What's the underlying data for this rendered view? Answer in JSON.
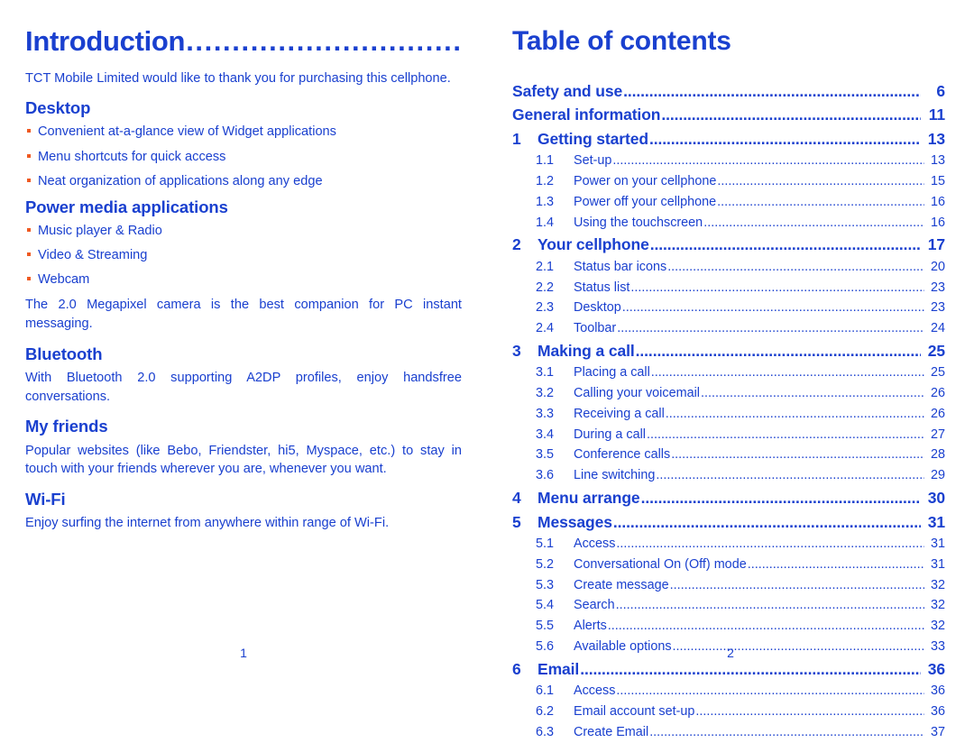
{
  "colors": {
    "text_blue": "#1a40cf",
    "bullet_orange": "#ef5a22"
  },
  "left_column": {
    "title": "Introduction",
    "title_leader": "..................................................................",
    "intro_paragraph": "TCT Mobile Limited would like to thank you for purchasing this cellphone.",
    "sections": [
      {
        "heading": "Desktop",
        "bullets": [
          "Convenient at-a-glance view of Widget applications",
          "Menu shortcuts for quick access",
          "Neat organization of applications along any edge"
        ],
        "paragraphs": []
      },
      {
        "heading": "Power media applications",
        "bullets": [
          "Music player & Radio",
          "Video & Streaming",
          "Webcam"
        ],
        "paragraphs": [
          "The 2.0 Megapixel camera is the best companion for PC instant messaging."
        ]
      },
      {
        "heading": "Bluetooth",
        "bullets": [],
        "paragraphs": [
          "With Bluetooth 2.0 supporting A2DP profiles, enjoy handsfree conversations."
        ]
      },
      {
        "heading": "My friends",
        "bullets": [],
        "paragraphs": [
          "Popular websites (like Bebo, Friendster, hi5, Myspace, etc.) to stay in touch with your friends wherever you are, whenever you want."
        ]
      },
      {
        "heading": "Wi-Fi",
        "bullets": [],
        "paragraphs": [
          "Enjoy surfing the internet from anywhere within range of Wi-Fi."
        ]
      }
    ],
    "folio": "1"
  },
  "right_column": {
    "title": "Table of contents",
    "entries": [
      {
        "level": 0,
        "number": "",
        "label": "Safety and use",
        "page": "6"
      },
      {
        "level": 0,
        "number": "",
        "label": "General information ",
        "page": "11"
      },
      {
        "level": 1,
        "number": "1",
        "label": "Getting started",
        "page": "13"
      },
      {
        "level": 2,
        "number": "1.1",
        "label": "Set-up ",
        "page": "13"
      },
      {
        "level": 2,
        "number": "1.2",
        "label": "Power on your cellphone",
        "page": "15"
      },
      {
        "level": 2,
        "number": "1.3",
        "label": "Power off your cellphone",
        "page": "16"
      },
      {
        "level": 2,
        "number": "1.4",
        "label": "Using the touchscreen ",
        "page": "16"
      },
      {
        "level": 1,
        "number": "2",
        "label": "Your cellphone ",
        "page": "17"
      },
      {
        "level": 2,
        "number": "2.1",
        "label": "Status bar icons  ",
        "page": "20"
      },
      {
        "level": 2,
        "number": "2.2",
        "label": "Status list",
        "page": "23"
      },
      {
        "level": 2,
        "number": "2.3",
        "label": "Desktop ",
        "page": "23"
      },
      {
        "level": 2,
        "number": "2.4",
        "label": "Toolbar ",
        "page": "24"
      },
      {
        "level": 1,
        "number": "3",
        "label": "Making a call",
        "page": "25"
      },
      {
        "level": 2,
        "number": "3.1",
        "label": "Placing a call",
        "page": "25"
      },
      {
        "level": 2,
        "number": "3.2",
        "label": "Calling your voicemail ",
        "page": "26"
      },
      {
        "level": 2,
        "number": "3.3",
        "label": "Receiving a call",
        "page": "26"
      },
      {
        "level": 2,
        "number": "3.4",
        "label": "During a call  ",
        "page": "27"
      },
      {
        "level": 2,
        "number": "3.5",
        "label": "Conference calls ",
        "page": "28"
      },
      {
        "level": 2,
        "number": "3.6",
        "label": "Line switching",
        "page": "29"
      },
      {
        "level": 1,
        "number": "4",
        "label": "Menu arrange ",
        "page": "30"
      },
      {
        "level": 1,
        "number": "5",
        "label": "Messages ",
        "page": "31"
      },
      {
        "level": 2,
        "number": "5.1",
        "label": "Access ",
        "page": "31"
      },
      {
        "level": 2,
        "number": "5.2",
        "label": "Conversational On (Off) mode ",
        "page": "31"
      },
      {
        "level": 2,
        "number": "5.3",
        "label": "Create message",
        "page": "32"
      },
      {
        "level": 2,
        "number": "5.4",
        "label": "Search",
        "page": "32"
      },
      {
        "level": 2,
        "number": "5.5",
        "label": "Alerts",
        "page": "32"
      },
      {
        "level": 2,
        "number": "5.6",
        "label": "Available options",
        "page": "33"
      },
      {
        "level": 1,
        "number": "6",
        "label": "Email",
        "page": "36"
      },
      {
        "level": 2,
        "number": "6.1",
        "label": "Access ",
        "page": "36"
      },
      {
        "level": 2,
        "number": "6.2",
        "label": "Email account set-up",
        "page": "36"
      },
      {
        "level": 2,
        "number": "6.3",
        "label": "Create Email ",
        "page": "37"
      }
    ],
    "folio": "2"
  }
}
